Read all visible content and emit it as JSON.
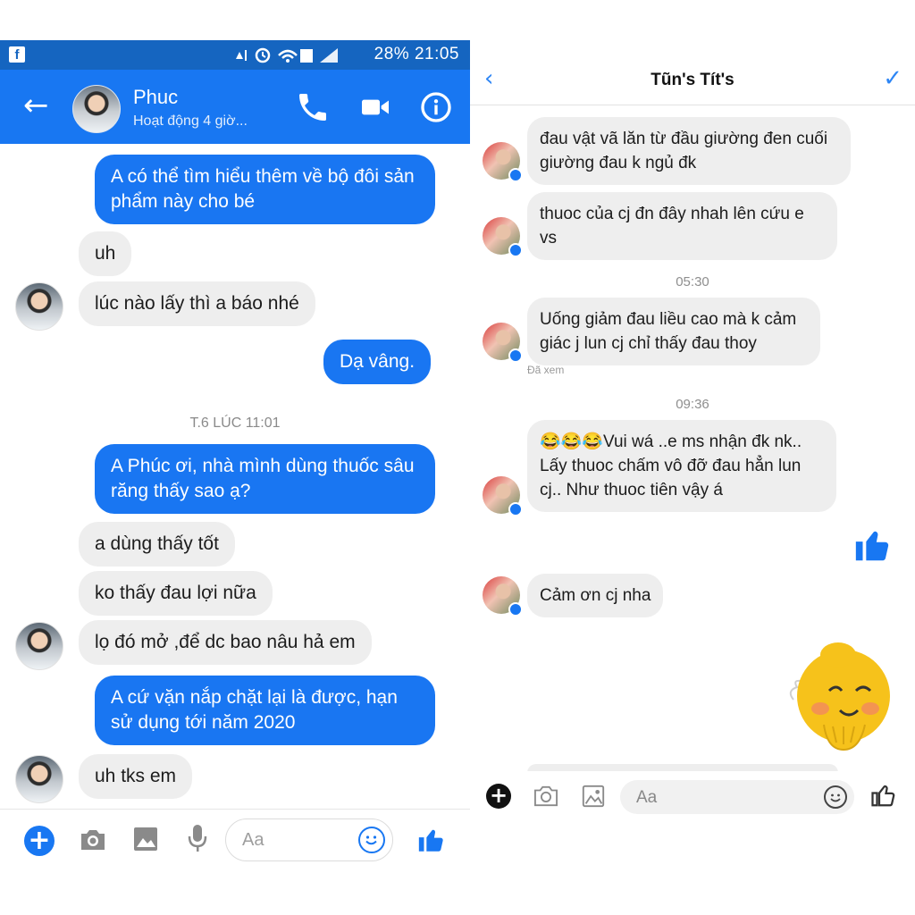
{
  "left": {
    "status_bar": {
      "fb_glyph": "f",
      "text": "28% 21:05"
    },
    "header": {
      "back_glyph": "←",
      "name": "Phuc",
      "status": "Hoạt động 4 giờ..."
    },
    "messages": [
      {
        "from": "me",
        "text": "A có thể tìm hiểu thêm về bộ đôi sản phẩm này cho bé"
      },
      {
        "from": "them",
        "text": "uh"
      },
      {
        "from": "them",
        "text": "lúc nào lấy thì a báo nhé"
      },
      {
        "from": "me",
        "text": "Dạ vâng."
      },
      {
        "from": "me",
        "text": "A Phúc ơi, nhà mình dùng thuốc sâu răng thấy sao ạ?"
      },
      {
        "from": "them",
        "text": "a dùng thấy tốt"
      },
      {
        "from": "them",
        "text": "ko thấy đau lợi nữa"
      },
      {
        "from": "them",
        "text": "lọ đó mở ,để dc bao nâu hả em"
      },
      {
        "from": "me",
        "text": "A cứ vặn nắp chặt lại là được, hạn sử dụng tới năm 2020"
      },
      {
        "from": "them",
        "text": "uh tks em"
      }
    ],
    "timestamp": "T.6 LÚC 11:01",
    "composer": {
      "placeholder": "Aa"
    }
  },
  "right": {
    "header": {
      "back_glyph": "‹",
      "title": "Tũn's Tít's",
      "check_glyph": "✓"
    },
    "messages": [
      {
        "text": "đau vật vã lăn từ đầu giường đen cuối giường đau k ngủ đk"
      },
      {
        "text": "thuoc của cj đn đây nhah lên cứu e vs"
      },
      {
        "text": "Uống giảm đau liều cao mà k cảm giác j lun cj chỉ thấy đau thoy"
      },
      {
        "text": "😂😂😂Vui wá ..e ms nhận đk nk.. Lấy thuoc chấm vô đỡ đau hẳn lun cj.. Như thuoc tiên vậy á"
      },
      {
        "text": "Cảm ơn cj nha"
      }
    ],
    "timestamps": [
      "05:30",
      "09:36"
    ],
    "seen_label": "Đã xem",
    "composer": {
      "placeholder": "Aa"
    }
  },
  "colors": {
    "messenger_blue": "#1877f2",
    "bubble_gray": "#eeeeee",
    "status_blue": "#1565c0"
  },
  "icons": [
    "phone-icon",
    "video-icon",
    "info-icon",
    "camera-icon",
    "gallery-icon",
    "mic-icon",
    "smile-icon",
    "like-icon",
    "sticker-icon"
  ]
}
